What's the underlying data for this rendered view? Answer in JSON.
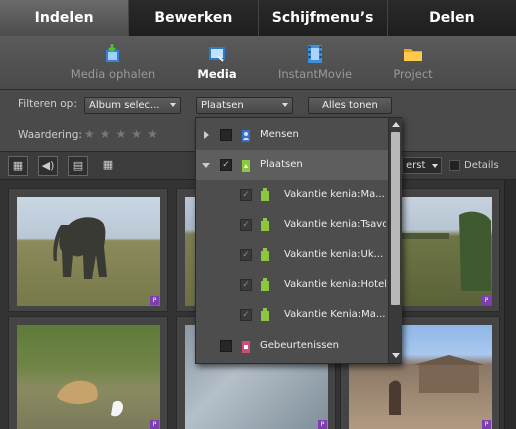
{
  "tabs": [
    {
      "label": "Indelen",
      "active": true
    },
    {
      "label": "Bewerken",
      "active": false
    },
    {
      "label": "Schijfmenu’s",
      "active": false
    },
    {
      "label": "Delen",
      "active": false
    }
  ],
  "subnav": [
    {
      "label": "Media ophalen",
      "icon": "media-import-icon",
      "active": false
    },
    {
      "label": "Media",
      "icon": "media-icon",
      "active": true
    },
    {
      "label": "InstantMovie",
      "icon": "film-icon",
      "active": false
    },
    {
      "label": "Project",
      "icon": "folder-icon",
      "active": false
    }
  ],
  "filter": {
    "label": "Filteren op:",
    "album_value": "Album selec...",
    "places_value": "Plaatsen",
    "show_all": "Alles tonen",
    "rating_label": "Waardering:",
    "stars": "★★★★★"
  },
  "viewbar": {
    "sort_suffix": "erst",
    "details_label": "Details"
  },
  "popup": {
    "items": [
      {
        "label": "Mensen",
        "checked": false,
        "expanded": false,
        "icon": "people-tag-icon",
        "level": 0
      },
      {
        "label": "Plaatsen",
        "checked": true,
        "expanded": true,
        "icon": "places-tag-icon",
        "level": 0
      },
      {
        "label": "Vakantie kenia:Ma...",
        "checked": true,
        "icon": "place-tag-icon",
        "level": 1
      },
      {
        "label": "Vakantie kenia:Tsavo",
        "checked": true,
        "icon": "place-tag-icon",
        "level": 1
      },
      {
        "label": "Vakantie kenia:Uk...",
        "checked": true,
        "icon": "place-tag-icon",
        "level": 1
      },
      {
        "label": "Vakantie kenia:Hotel",
        "checked": true,
        "icon": "place-tag-icon",
        "level": 1
      },
      {
        "label": "Vakantie Kenia:Ma...",
        "checked": true,
        "icon": "place-tag-icon",
        "level": 1
      },
      {
        "label": "Gebeurtenissen",
        "checked": false,
        "expanded": false,
        "icon": "events-tag-icon",
        "level": 0
      }
    ]
  },
  "thumbs": [
    {
      "badge": "P"
    },
    {
      "badge": "P"
    },
    {
      "badge": "P"
    },
    {
      "badge": "P"
    },
    {
      "badge": "P"
    },
    {
      "badge": "P"
    }
  ],
  "colors": {
    "accent": "#7b3fb0",
    "active_tab": "#5a5a5a",
    "place_tag": "#8dc63f",
    "people_tag": "#3a6fc8",
    "event_tag": "#d04a7a"
  }
}
